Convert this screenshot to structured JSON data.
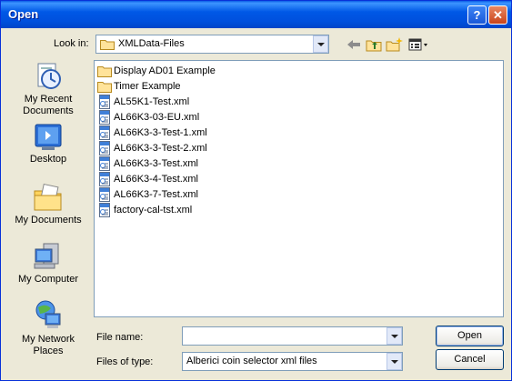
{
  "window": {
    "title": "Open",
    "help_label": "?",
    "close_label": "✕"
  },
  "look_in": {
    "label": "Look in:",
    "value": "XMLData-Files"
  },
  "toolbar": {
    "icons": [
      "back-arrow-icon",
      "up-folder-icon",
      "new-folder-icon",
      "views-menu-icon"
    ]
  },
  "places": [
    {
      "label": "My Recent Documents",
      "icon": "recent-documents-icon"
    },
    {
      "label": "Desktop",
      "icon": "desktop-icon"
    },
    {
      "label": "My Documents",
      "icon": "my-documents-icon"
    },
    {
      "label": "My Computer",
      "icon": "my-computer-icon"
    },
    {
      "label": "My Network Places",
      "icon": "network-places-icon"
    }
  ],
  "files": [
    {
      "name": "Display AD01 Example",
      "type": "folder"
    },
    {
      "name": "Timer Example",
      "type": "folder"
    },
    {
      "name": "AL55K1-Test.xml",
      "type": "xml"
    },
    {
      "name": "AL66K3-03-EU.xml",
      "type": "xml"
    },
    {
      "name": "AL66K3-3-Test-1.xml",
      "type": "xml"
    },
    {
      "name": "AL66K3-3-Test-2.xml",
      "type": "xml"
    },
    {
      "name": "AL66K3-3-Test.xml",
      "type": "xml"
    },
    {
      "name": "AL66K3-4-Test.xml",
      "type": "xml"
    },
    {
      "name": "AL66K3-7-Test.xml",
      "type": "xml"
    },
    {
      "name": "factory-cal-tst.xml",
      "type": "xml"
    }
  ],
  "file_name": {
    "label": "File name:",
    "value": ""
  },
  "file_type": {
    "label": "Files of type:",
    "value": "Alberici coin selector xml files"
  },
  "buttons": {
    "open": "Open",
    "cancel": "Cancel"
  },
  "colors": {
    "titlebar": "#0058E6",
    "dialog_bg": "#ECE9D8",
    "border": "#7F9DB9"
  }
}
